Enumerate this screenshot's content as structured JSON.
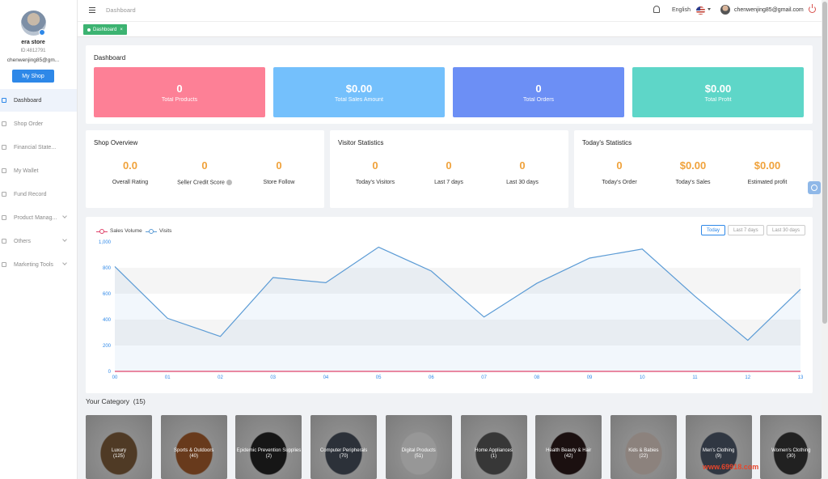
{
  "sidebar": {
    "store_name": "era store",
    "store_id": "ID:4812791",
    "email": "chenwenjing85@gm...",
    "my_shop_label": "My Shop",
    "items": [
      {
        "label": "Dashboard",
        "icon": "dashboard-icon",
        "active": true,
        "has_children": false
      },
      {
        "label": "Shop Order",
        "icon": "order-icon",
        "active": false,
        "has_children": false
      },
      {
        "label": "Financial State...",
        "icon": "finance-icon",
        "active": false,
        "has_children": false
      },
      {
        "label": "My Wallet",
        "icon": "wallet-icon",
        "active": false,
        "has_children": false
      },
      {
        "label": "Fund Record",
        "icon": "record-icon",
        "active": false,
        "has_children": false
      },
      {
        "label": "Product Manag...",
        "icon": "product-icon",
        "active": false,
        "has_children": true
      },
      {
        "label": "Others",
        "icon": "others-icon",
        "active": false,
        "has_children": true
      },
      {
        "label": "Marketing Tools",
        "icon": "marketing-icon",
        "active": false,
        "has_children": true
      }
    ]
  },
  "header": {
    "breadcrumb": "Dashboard",
    "language": "English",
    "user_email": "chenwenjing85@gmail.com"
  },
  "tabs": [
    {
      "label": "Dashboard",
      "close": "×"
    }
  ],
  "dashboard": {
    "title": "Dashboard",
    "stats": [
      {
        "value": "0",
        "label": "Total Products",
        "color": "#fd8096"
      },
      {
        "value": "$0.00",
        "label": "Total Sales Amount",
        "color": "#74c0fc"
      },
      {
        "value": "0",
        "label": "Total Orders",
        "color": "#6c8ff5"
      },
      {
        "value": "$0.00",
        "label": "Total Profit",
        "color": "#5ed6c8"
      }
    ]
  },
  "shop_overview": {
    "title": "Shop Overview",
    "metrics": [
      {
        "value": "0.0",
        "label": "Overall Rating"
      },
      {
        "value": "0",
        "label": "Seller Credit Score"
      },
      {
        "value": "0",
        "label": "Store Follow"
      }
    ]
  },
  "visitor_statistics": {
    "title": "Visitor Statistics",
    "metrics": [
      {
        "value": "0",
        "label": "Today's Visitors"
      },
      {
        "value": "0",
        "label": "Last 7 days"
      },
      {
        "value": "0",
        "label": "Last 30 days"
      }
    ]
  },
  "todays_statistics": {
    "title": "Today's Statistics",
    "metrics": [
      {
        "value": "0",
        "label": "Today's Order"
      },
      {
        "value": "$0.00",
        "label": "Today's Sales"
      },
      {
        "value": "$0.00",
        "label": "Estimated profit"
      }
    ]
  },
  "chart_controls": {
    "ranges": [
      {
        "label": "Today",
        "active": true
      },
      {
        "label": "Last 7 days",
        "active": false
      },
      {
        "label": "Last 30 days",
        "active": false
      }
    ]
  },
  "chart_data": {
    "type": "line",
    "x": [
      "00",
      "01",
      "02",
      "03",
      "04",
      "05",
      "06",
      "07",
      "08",
      "09",
      "10",
      "11",
      "12",
      "13"
    ],
    "series": [
      {
        "name": "Sales Volume",
        "color": "#e0436b",
        "values": [
          0,
          0,
          0,
          0,
          0,
          0,
          0,
          0,
          0,
          0,
          0,
          0,
          0,
          0
        ]
      },
      {
        "name": "Visits",
        "color": "#5b9bd5",
        "values": [
          810,
          410,
          270,
          725,
          685,
          960,
          775,
          420,
          680,
          875,
          945,
          580,
          240,
          635
        ]
      }
    ],
    "yticks": [
      "0",
      "200",
      "400",
      "600",
      "800",
      "1,000"
    ],
    "ylim": [
      0,
      1000
    ],
    "grid": true,
    "legend": "top-left"
  },
  "categories": {
    "title": "Your Category",
    "count": "(15)",
    "items": [
      {
        "name": "Luxury",
        "count": "(125)",
        "color": "#7a5a3a"
      },
      {
        "name": "Sports & Outdoors",
        "count": "(40)",
        "color": "#a05a2c"
      },
      {
        "name": "Epidemic Prevention Supplies",
        "count": "(2)",
        "color": "#222222"
      },
      {
        "name": "Computer Peripherals",
        "count": "(70)",
        "color": "#444c58"
      },
      {
        "name": "Digital Products",
        "count": "(51)",
        "color": "#e8e8e8"
      },
      {
        "name": "Home Appliances",
        "count": "(1)",
        "color": "#555555"
      },
      {
        "name": "Health Beauty & Hair",
        "count": "(42)",
        "color": "#2a1a1a"
      },
      {
        "name": "Kids & Babies",
        "count": "(22)",
        "color": "#d8c8c0"
      },
      {
        "name": "Men's Clothing",
        "count": "(9)",
        "color": "#4a5566"
      },
      {
        "name": "Women's Clothing",
        "count": "(30)",
        "color": "#333333"
      }
    ]
  },
  "watermark": "www.69918.com"
}
